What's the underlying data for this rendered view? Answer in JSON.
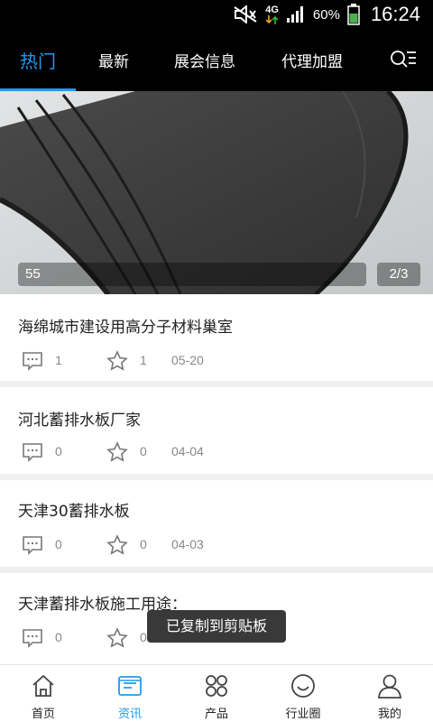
{
  "status_bar": {
    "network": "4G",
    "battery_percent": "60%",
    "time": "16:24",
    "icons": [
      "mute-icon",
      "network-4g-icon",
      "signal-icon",
      "battery-icon"
    ]
  },
  "top_nav": {
    "tabs": [
      {
        "label": "热门",
        "active": true
      },
      {
        "label": "最新",
        "active": false
      },
      {
        "label": "展会信息",
        "active": false
      },
      {
        "label": "代理加盟",
        "active": false
      }
    ],
    "menu_icon": "search-list-icon",
    "accent_color": "#1e9bf0"
  },
  "banner": {
    "caption": "55",
    "page_indicator": "2/3"
  },
  "articles": [
    {
      "title": "海绵城市建设用高分子材料巢室",
      "comments": "1",
      "favorites": "1",
      "date": "05-20"
    },
    {
      "title": "河北蓄排水板厂家",
      "comments": "0",
      "favorites": "0",
      "date": "04-04"
    },
    {
      "title": "天津30蓄排水板",
      "comments": "0",
      "favorites": "0",
      "date": "04-03"
    },
    {
      "title": "天津蓄排水板施工用途：",
      "comments": "0",
      "favorites": "0",
      "date": ""
    }
  ],
  "toast": {
    "text": "已复制到剪贴板"
  },
  "bottom_nav": {
    "items": [
      {
        "label": "首页",
        "icon": "home-icon",
        "active": false
      },
      {
        "label": "资讯",
        "icon": "news-icon",
        "active": true
      },
      {
        "label": "产品",
        "icon": "products-icon",
        "active": false
      },
      {
        "label": "行业圈",
        "icon": "community-icon",
        "active": false
      },
      {
        "label": "我的",
        "icon": "profile-icon",
        "active": false
      }
    ]
  }
}
